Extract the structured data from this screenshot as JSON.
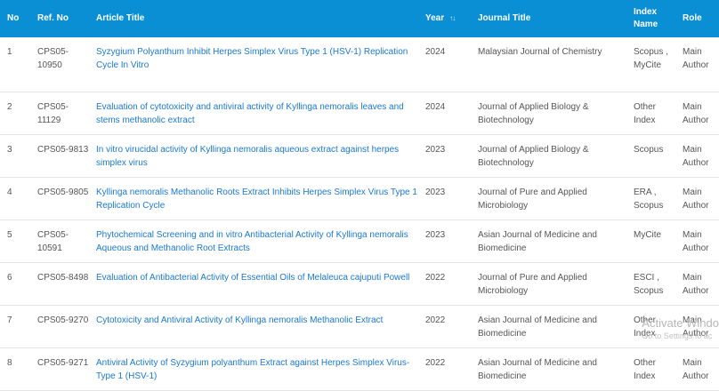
{
  "headers": {
    "no": "No",
    "ref": "Ref. No",
    "title": "Article Title",
    "year": "Year",
    "journal": "Journal Title",
    "index": "Index Name",
    "role": "Role"
  },
  "rows": [
    {
      "no": "1",
      "ref": "CPS05-10950",
      "title": "Syzygium Polyanthum Inhibit Herpes Simplex Virus Type 1 (HSV-1) Replication Cycle In Vitro",
      "year": "2024",
      "journal": "Malaysian Journal of Chemistry",
      "index": "Scopus , MyCite",
      "role": "Main Author"
    },
    {
      "no": "2",
      "ref": "CPS05-11129",
      "title": "Evaluation of cytotoxicity and antiviral activity of Kyllinga nemoralis leaves and stems methanolic extract",
      "year": "2024",
      "journal": "Journal of Applied Biology & Biotechnology",
      "index": "Other Index",
      "role": "Main Author"
    },
    {
      "no": "3",
      "ref": "CPS05-9813",
      "title": "In vitro virucidal activity of Kyllinga nemoralis aqueous extract against herpes simplex virus",
      "year": "2023",
      "journal": "Journal of Applied Biology & Biotechnology",
      "index": "Scopus",
      "role": "Main Author"
    },
    {
      "no": "4",
      "ref": "CPS05-9805",
      "title": "Kyllinga nemoralis Methanolic Roots Extract Inhibits Herpes Simplex Virus Type 1 Replication Cycle",
      "year": "2023",
      "journal": "Journal of Pure and Applied Microbiology",
      "index": "ERA , Scopus",
      "role": "Main Author"
    },
    {
      "no": "5",
      "ref": "CPS05-10591",
      "title": "Phytochemical Screening and in vitro Antibacterial Activity of Kyllinga nemoralis Aqueous and Methanolic Root Extracts",
      "year": "2023",
      "journal": "Asian Journal of Medicine and Biomedicine",
      "index": "MyCite",
      "role": "Main Author"
    },
    {
      "no": "6",
      "ref": "CPS05-8498",
      "title": "Evaluation of Antibacterial Activity of Essential Oils of Melaleuca cajuputi Powell",
      "year": "2022",
      "journal": "Journal of Pure and Applied Microbiology",
      "index": "ESCI , Scopus",
      "role": "Main Author"
    },
    {
      "no": "7",
      "ref": "CPS05-9270",
      "title": "Cytotoxicity and Antiviral Activity of Kyllinga nemoralis Methanolic Extract",
      "year": "2022",
      "journal": "Asian Journal of Medicine and Biomedicine",
      "index": "Other Index",
      "role": "Main Author"
    },
    {
      "no": "8",
      "ref": "CPS05-9271",
      "title": "Antiviral Activity of Syzygium polyanthum Extract against Herpes Simplex Virus-Type 1 (HSV-1)",
      "year": "2022",
      "journal": "Asian Journal of Medicine and Biomedicine",
      "index": "Other Index",
      "role": "Main Author"
    }
  ],
  "watermark": {
    "line1": "Activate Windo",
    "line2": "Go to Settings to ac"
  },
  "icons": {
    "year_sort": "sort-updown-icon"
  },
  "colors": {
    "header_bg": "#0b8fd4",
    "link": "#1a78d6",
    "text": "#555555"
  }
}
